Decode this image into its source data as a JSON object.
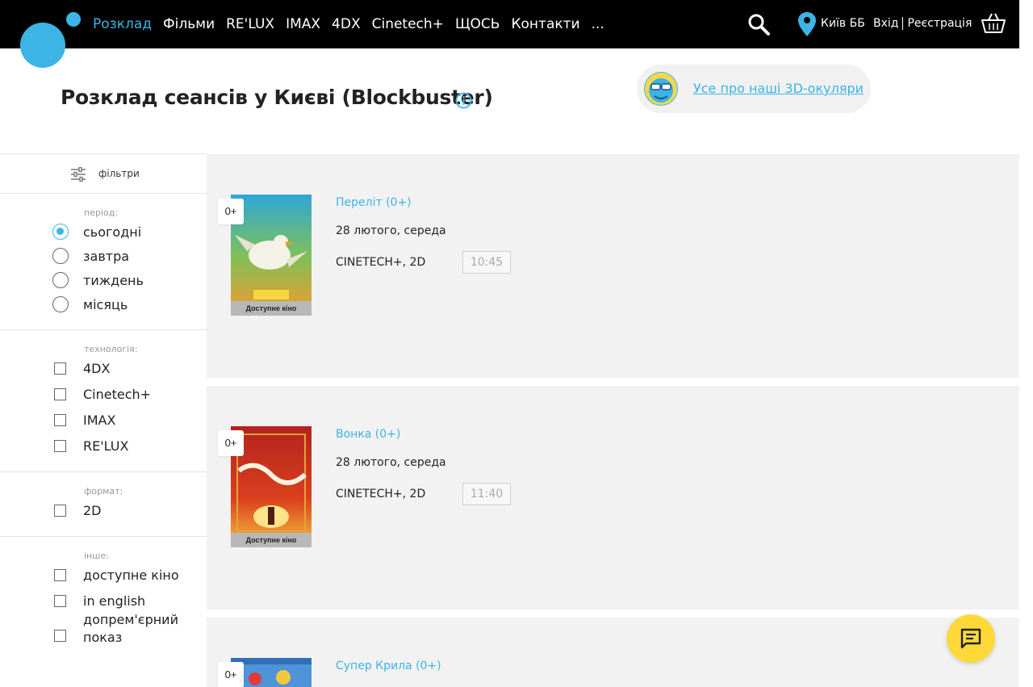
{
  "header": {
    "nav": [
      "Розклад",
      "Фільми",
      "RE'LUX",
      "IMAX",
      "4DX",
      "Cinetech+",
      "ЩОСЬ",
      "Контакти",
      "..."
    ],
    "active_nav": "Розклад",
    "city": "Київ ББ",
    "login": "Вхід",
    "register": "Реєстрація",
    "icons": [
      "logo",
      "search-icon",
      "location-pin-icon",
      "basket-icon"
    ]
  },
  "page": {
    "title": "Розклад сеансів у Києві (Blockbuster)",
    "glasses_link": "Усе про наші 3D-окуляри"
  },
  "filters": {
    "header": "фільтри",
    "period": {
      "label": "період:",
      "options": [
        "сьогодні",
        "завтра",
        "тиждень",
        "місяць"
      ],
      "selected": "сьогодні"
    },
    "technology": {
      "label": "технологія:",
      "options": [
        "4DX",
        "Cinetech+",
        "IMAX",
        "RE'LUX"
      ]
    },
    "format": {
      "label": "формат:",
      "options": [
        "2D"
      ]
    },
    "other": {
      "label": "інше:",
      "options": [
        "доступне кіно",
        "in english",
        "допрем'єрний",
        "показ"
      ]
    }
  },
  "sessions": [
    {
      "age": "0+",
      "title": "Переліт (0+)",
      "date": "28 лютого, середа",
      "format": "CINETECH+, 2D",
      "time": "10:45",
      "caption": "Доступне кіно"
    },
    {
      "age": "0+",
      "title": "Вонка (0+)",
      "date": "28 лютого, середа",
      "format": "CINETECH+, 2D",
      "time": "11:40",
      "caption": "Доступне кіно"
    },
    {
      "age": "0+",
      "title": "Супер Крила (0+)"
    }
  ],
  "colors": {
    "accent": "#3cb4e5",
    "header_bg": "#000000",
    "chat_button": "#ffd93a",
    "session_bg": "#f2f2f2"
  }
}
